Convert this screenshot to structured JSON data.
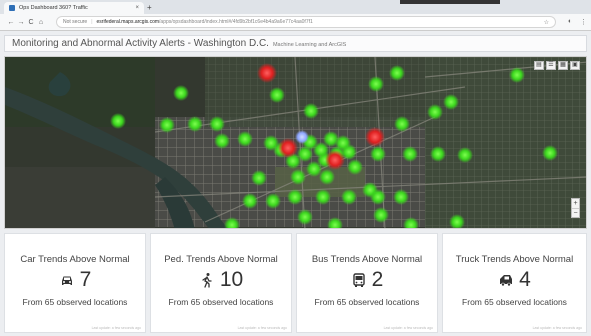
{
  "browser": {
    "tab_title": "Ops Dashboard 360? Traffic",
    "tab_close": "×",
    "new_tab": "+",
    "back": "←",
    "forward": "→",
    "reload": "C",
    "home": "⌂",
    "address_secure": "Not secure",
    "address_host": "esrifederal.maps.arcgis.com",
    "address_path": "/apps/opsdashboard/index.html#/4fd9b2bf1c6e4b4a9a6e77c4aa0f7f1",
    "star": "☆",
    "menu": "⋮"
  },
  "dashboard": {
    "title": "Monitoring and Abnormal Activity Alerts - Washington D.C.",
    "subtitle": "Machine Learning and ArcGIS"
  },
  "map": {
    "tools": [
      "▤",
      "☰",
      "▦",
      "▣"
    ],
    "zoom_in": "+",
    "zoom_out": "−",
    "colors": {
      "normal": "#3cd61e",
      "alert": "#e02020",
      "selected": "#8fa6ff"
    }
  },
  "cards": [
    {
      "title": "Car Trends Above Normal",
      "value": "7",
      "icon": "car-icon",
      "sub": "From 65 observed locations",
      "footer": "Last update: a few seconds ago"
    },
    {
      "title": "Ped. Trends Above Normal",
      "value": "10",
      "icon": "pedestrian-icon",
      "sub": "From 65 observed locations",
      "footer": "Last update: a few seconds ago"
    },
    {
      "title": "Bus Trends Above Normal",
      "value": "2",
      "icon": "bus-icon",
      "sub": "From 65 observed locations",
      "footer": "Last update: a few seconds ago"
    },
    {
      "title": "Truck Trends Above Normal",
      "value": "4",
      "icon": "truck-icon",
      "sub": "From 65 observed locations",
      "footer": "Last update: a few seconds ago"
    }
  ]
}
